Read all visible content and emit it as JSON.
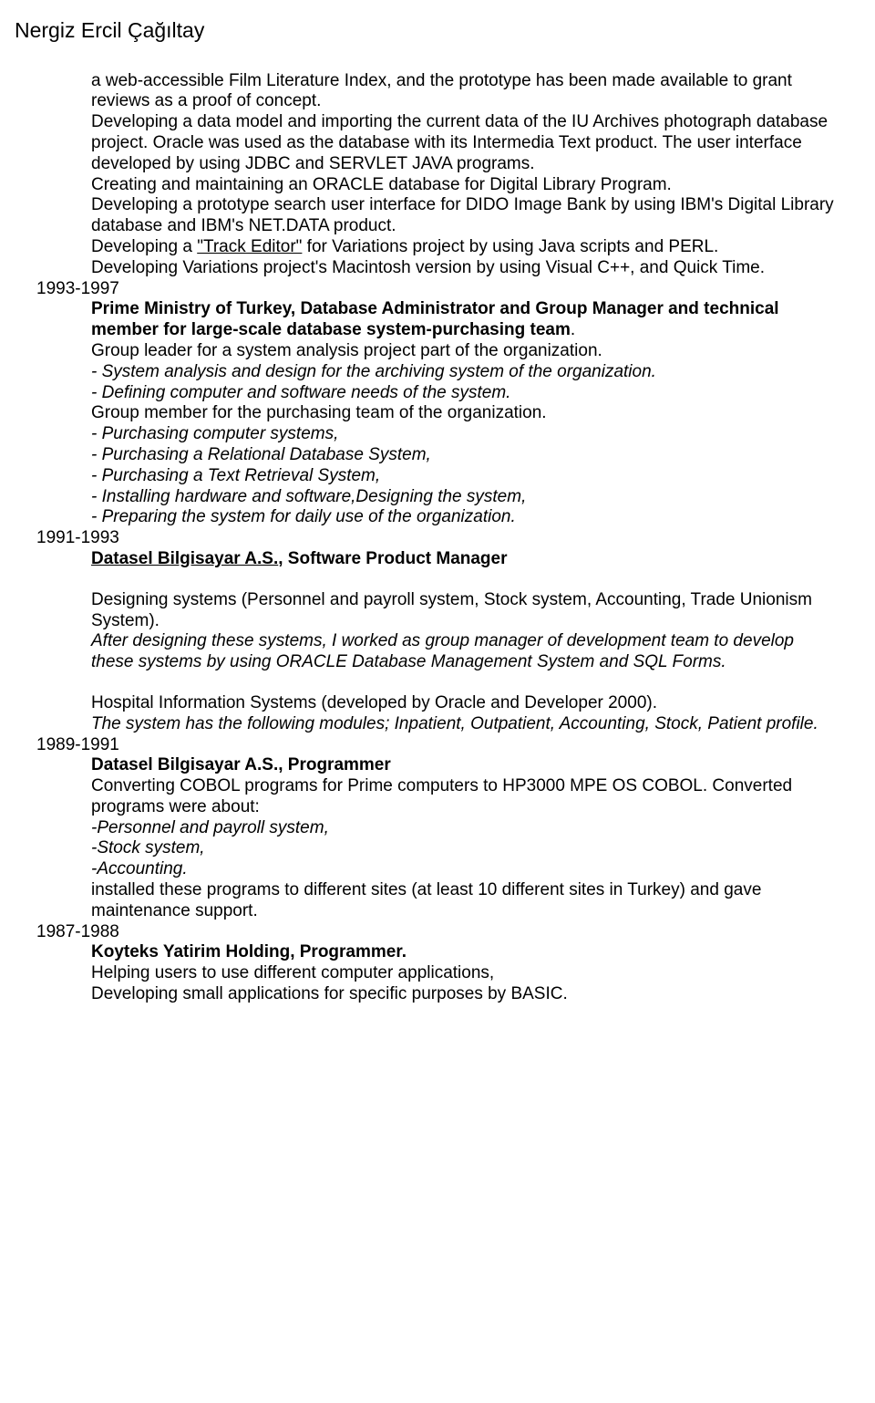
{
  "header": {
    "name": "Nergiz Ercil Çağıltay"
  },
  "sections": {
    "intro": {
      "p1": "a web-accessible Film Literature Index, and the prototype has been made available to grant reviews as a proof of concept.",
      "p2": "Developing a data model and importing the current data of the IU Archives photograph database project. Oracle was used as the database with its Intermedia Text product. The user interface developed by using JDBC and SERVLET JAVA programs.",
      "p3": "Creating and maintaining an ORACLE database for Digital Library Program.",
      "p4": "Developing a prototype search user interface for DIDO Image Bank by using IBM's Digital Library database and IBM's NET.DATA product.",
      "p5_1": "Developing a ",
      "p5_link": "\"Track Editor\"",
      "p5_2": " for Variations project by using Java scripts and PERL.",
      "p6": "Developing Variations project's Macintosh version by using Visual C++, and Quick Time."
    },
    "job1": {
      "year": "1993-1997",
      "title1": "Prime Ministry of Turkey, Database Administrator and Group Manager and technical member for large-scale database system-purchasing team",
      "title1_end": ".",
      "l1": "Group leader for a system analysis project part of the organization.",
      "l2": "- System analysis and design for the archiving system of the organization.",
      "l3": "- Defining computer and software needs of the system.",
      "l4": "Group member for the purchasing team of the organization.",
      "l5": "- Purchasing computer systems,",
      "l6": "- Purchasing a Relational Database System,",
      "l7": "- Purchasing a Text Retrieval System,",
      "l8": "- Installing hardware and software,Designing the system,",
      "l9": "- Preparing the system for daily use of the organization."
    },
    "job2": {
      "year": "1991-1993",
      "title_link": "Datasel Bilgisayar A.S.",
      "title_rest": ", Software Product Manager",
      "p1": "Designing systems (Personnel and payroll system, Stock system, Accounting, Trade Unionism System).",
      "p2": "After designing these systems, I worked as group manager of development team to develop these systems by using ORACLE Database Management System and SQL Forms.",
      "p3": "Hospital Information Systems (developed by Oracle and Developer 2000).",
      "p4": "The system has the following modules; Inpatient, Outpatient, Accounting, Stock, Patient profile."
    },
    "job3": {
      "year": "1989-1991",
      "title": "Datasel Bilgisayar A.S., Programmer",
      "p1": "Converting COBOL programs for Prime computers to HP3000 MPE OS COBOL. Converted programs were about:",
      "l1": "-Personnel and payroll system,",
      "l2": "-Stock system,",
      "l3": "-Accounting.",
      "p2": "installed these programs to different sites (at least 10 different sites in Turkey) and gave maintenance support."
    },
    "job4": {
      "year": "1987-1988",
      "title": "Koyteks Yatirim Holding, Programmer.",
      "p1": "Helping users to use different computer applications,",
      "p2": "Developing small applications for specific purposes by BASIC."
    }
  }
}
